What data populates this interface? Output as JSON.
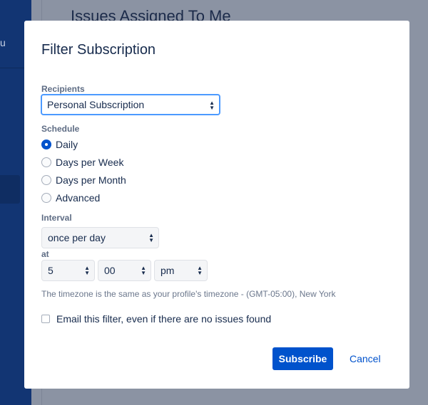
{
  "background": {
    "page_title": "Issues Assigned To Me",
    "sidebar_fragment": "u"
  },
  "modal": {
    "title": "Filter Subscription",
    "recipients": {
      "label": "Recipients",
      "value": "Personal Subscription"
    },
    "schedule": {
      "label": "Schedule",
      "options": [
        {
          "label": "Daily",
          "selected": true
        },
        {
          "label": "Days per Week",
          "selected": false
        },
        {
          "label": "Days per Month",
          "selected": false
        },
        {
          "label": "Advanced",
          "selected": false
        }
      ]
    },
    "interval": {
      "label": "Interval",
      "value": "once per day"
    },
    "at": {
      "label": "at",
      "hour": "5",
      "minute": "00",
      "ampm": "pm"
    },
    "timezone_note": "The timezone is the same as your profile's timezone - (GMT-05:00), New York",
    "email_checkbox": {
      "label": "Email this filter, even if there are no issues found",
      "checked": false
    },
    "subscribe_label": "Subscribe",
    "cancel_label": "Cancel"
  },
  "colors": {
    "primary": "#0052cc",
    "sidebar": "#123573",
    "overlay": "#8b93a3"
  }
}
